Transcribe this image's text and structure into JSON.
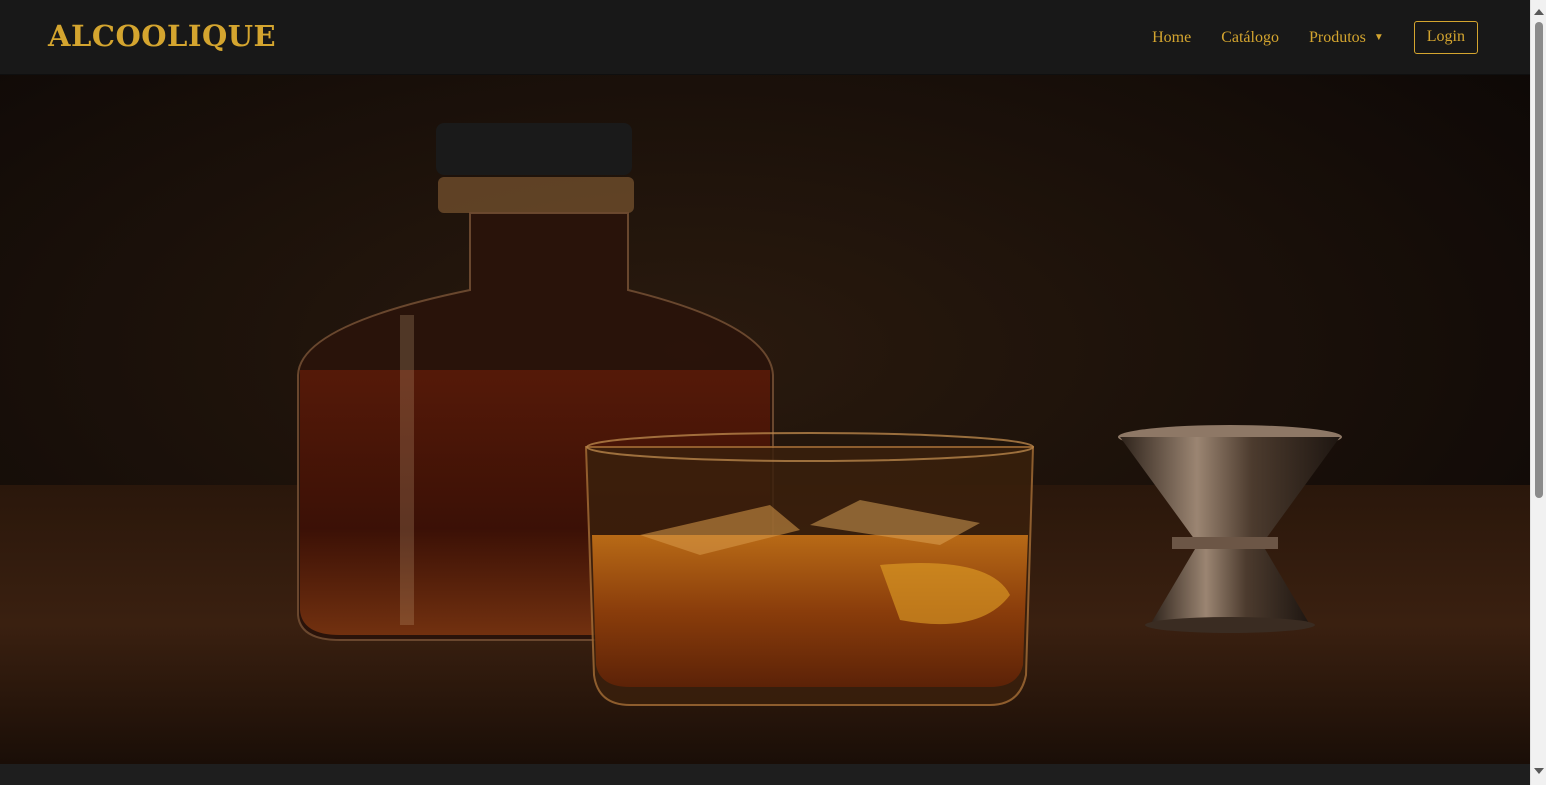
{
  "brand": {
    "name": "ALCOOLIQUE"
  },
  "nav": {
    "home": "Home",
    "catalog": "Catálogo",
    "products": "Produtos",
    "products_caret": "▼",
    "login": "Login"
  },
  "hero": {
    "image_icon": "whiskey-decanter-glass-photo"
  },
  "colors": {
    "accent": "#d4a52f",
    "navbar_bg": "#181818",
    "hero_bg": "#1b120b"
  }
}
